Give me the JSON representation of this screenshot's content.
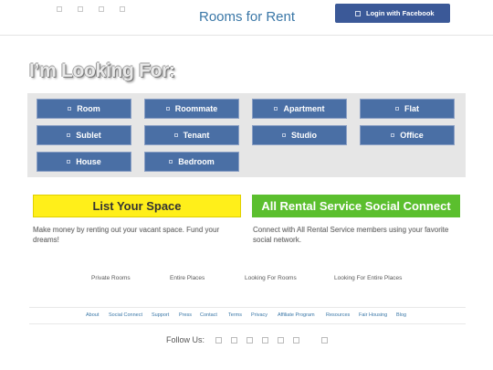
{
  "header": {
    "title": "Rooms for Rent",
    "login_label": "Login with Facebook",
    "top_icons": [
      "icon",
      "icon",
      "icon",
      "icon"
    ]
  },
  "hero": {
    "title": "I’m Looking For:"
  },
  "options": [
    {
      "label": "Room"
    },
    {
      "label": "Roommate"
    },
    {
      "label": "Apartment"
    },
    {
      "label": "Flat"
    },
    {
      "label": "Sublet"
    },
    {
      "label": "Tenant"
    },
    {
      "label": "Studio"
    },
    {
      "label": "Office"
    },
    {
      "label": "House"
    },
    {
      "label": "Bedroom"
    }
  ],
  "cta": {
    "list_label": "List Your Space",
    "list_desc": "Make money by renting out your vacant space. Fund your dreams!",
    "social_label": "All Rental Service Social Connect",
    "social_desc": "Connect with All Rental Service members using your favorite social network."
  },
  "footer_links": [
    "Private Rooms",
    "Entire Places",
    "Looking For Rooms",
    "Looking For Entire Places"
  ],
  "bottom_nav": [
    "About",
    "Social Connect",
    "Support",
    "Press",
    "Contact",
    "Terms",
    "Privacy",
    "Affiliate Program",
    "Resources",
    "Fair Housing",
    "Blog"
  ],
  "follow": {
    "label": "Follow Us:",
    "icons": [
      "social-icon",
      "social-icon",
      "social-icon",
      "social-icon",
      "social-icon",
      "social-icon",
      "social-icon"
    ]
  },
  "colors": {
    "accent": "#3a77a7",
    "facebook": "#3b5998",
    "option_bg": "#4a6fa5",
    "list_cta": "#ffef1a",
    "social_cta": "#5bbf2e"
  }
}
